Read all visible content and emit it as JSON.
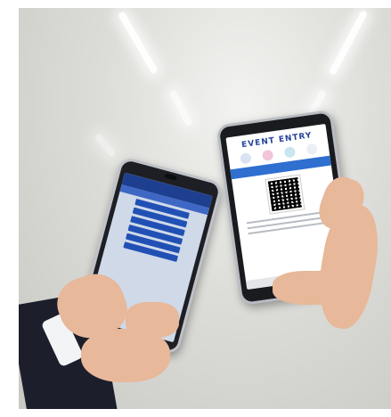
{
  "photo": {
    "phone_right": {
      "brand": "EVENT ENTRY"
    }
  }
}
